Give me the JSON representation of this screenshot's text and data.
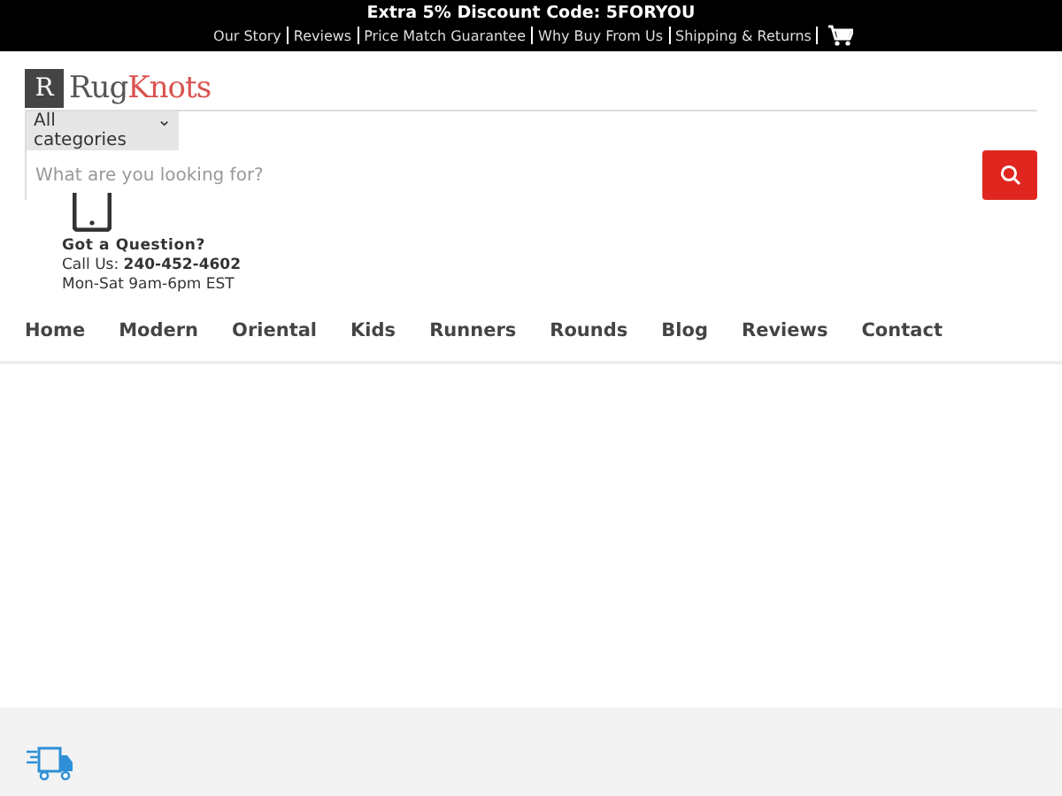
{
  "promo_bar": {
    "headline": "Extra 5% Discount Code: 5FORYOU",
    "links": [
      "Our Story",
      "Reviews",
      "Price Match Guarantee",
      "Why Buy From Us",
      "Shipping & Returns"
    ]
  },
  "header": {
    "logo": {
      "mark": "R",
      "text_first": "Rug",
      "text_second": "Knots"
    },
    "category_select": {
      "value": "All categories",
      "caret": "⌄"
    },
    "search": {
      "placeholder": "What are you looking for?"
    },
    "contact": {
      "heading": "Got a Question?",
      "call_label": "Call Us:",
      "phone": "240-452-4602",
      "hours": "Mon-Sat 9am-6pm EST"
    }
  },
  "nav": [
    "Home",
    "Modern",
    "Oriental",
    "Kids",
    "Runners",
    "Rounds",
    "Blog",
    "Reviews",
    "Contact"
  ]
}
